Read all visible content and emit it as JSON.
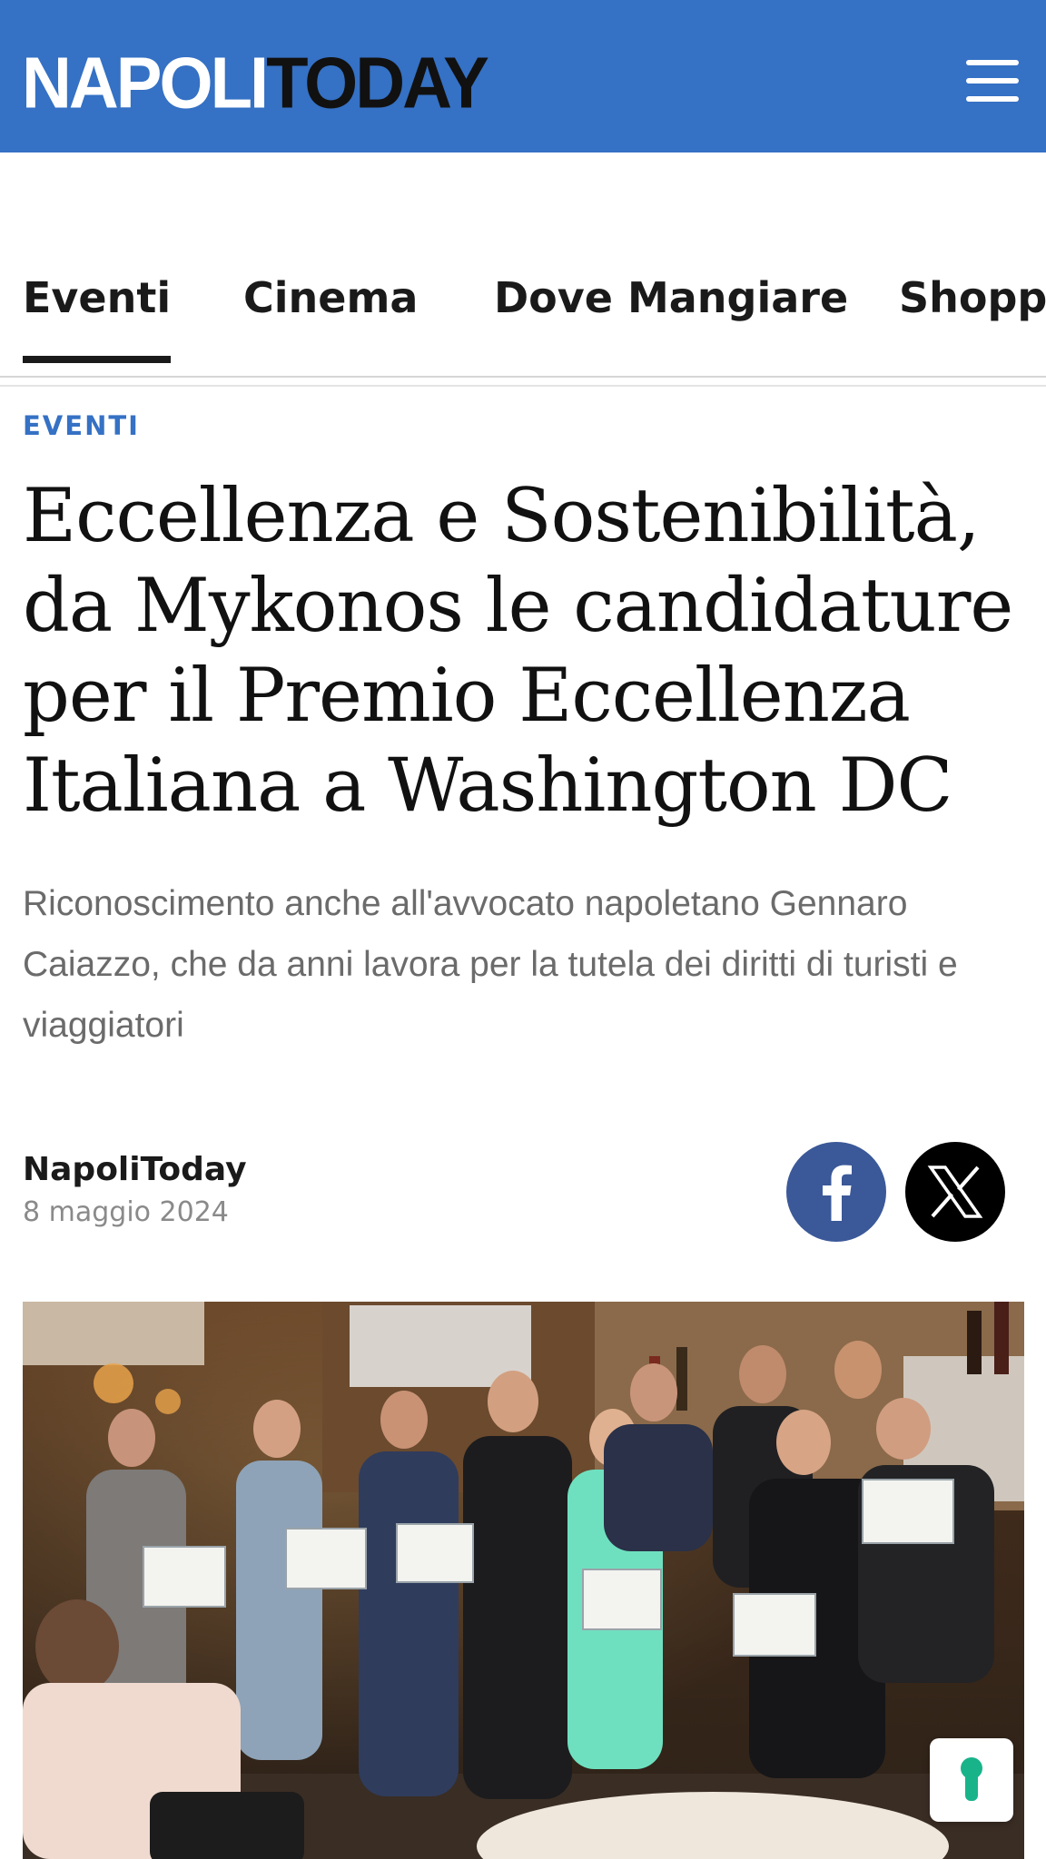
{
  "header": {
    "logo_part1": "NAPOLI",
    "logo_part2": "TODAY",
    "menu_icon": "hamburger-menu-icon",
    "background_color": "#3571c4"
  },
  "tabs": [
    {
      "label": "Eventi",
      "active": true
    },
    {
      "label": "Cinema",
      "active": false
    },
    {
      "label": "Dove Mangiare",
      "active": false
    },
    {
      "label": "Shopping",
      "active": false
    }
  ],
  "article": {
    "category": "EVENTI",
    "title": "Eccellenza e Sostenibilità, da Mykonos le candidature per il Premio Eccellenza Italiana a Washington DC",
    "subtitle": "Riconoscimento anche all'avvocato napoletano Gennaro Caiazzo, che da anni lavora per la tutela dei diritti di turisti e viaggiatori",
    "author": "NapoliToday",
    "date": "8 maggio 2024",
    "share": [
      {
        "network": "facebook",
        "icon": "facebook-icon",
        "color": "#3b5998"
      },
      {
        "network": "x",
        "icon": "x-icon",
        "color": "#000000"
      }
    ]
  },
  "feedback_button": {
    "icon": "feedback-icon",
    "color": "#19b38a"
  },
  "colors": {
    "accent": "#3571c4",
    "text": "#1a1a1a",
    "muted": "#6b6b6b"
  }
}
